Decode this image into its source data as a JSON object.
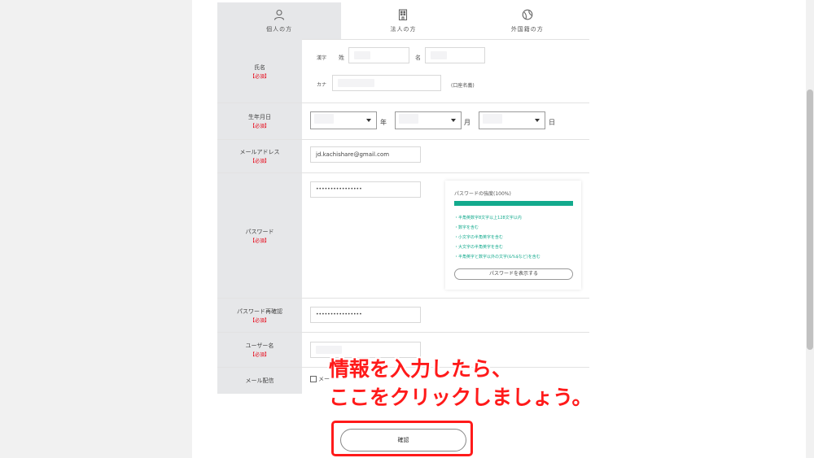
{
  "tabs": [
    {
      "label": "個人の方",
      "icon": "person-icon",
      "active": true
    },
    {
      "label": "法人の方",
      "icon": "building-icon",
      "active": false
    },
    {
      "label": "外国籍の方",
      "icon": "globe-icon",
      "active": false
    }
  ],
  "required_label": "【必須】",
  "name": {
    "label": "氏名",
    "kanji_label": "漢字",
    "last_label": "姓",
    "first_label": "名",
    "kana_label": "カナ",
    "kana_note": "(口座名義)"
  },
  "birthdate": {
    "label": "生年月日",
    "year_unit": "年",
    "month_unit": "月",
    "day_unit": "日"
  },
  "email": {
    "label": "メールアドレス",
    "value": "jd.kachishare@gmail.com"
  },
  "password": {
    "label": "パスワード",
    "value": "••••••••••••••••",
    "strength_title": "パスワードの強度(100%)",
    "strength_percent": 100,
    "rules": [
      "・半角英数字8文字以上128文字以内",
      "・数字を含む",
      "・小文字の半角英字を含む",
      "・大文字の半角英字を含む",
      "・半角英字と数字以外の文字(&%$など)を含む"
    ],
    "show_button": "パスワードを表示する"
  },
  "password_confirm": {
    "label": "パスワード再確認",
    "value": "••••••••••••••••"
  },
  "username": {
    "label": "ユーザー名"
  },
  "newsletter": {
    "label": "メール配信",
    "checkbox_text": "メー"
  },
  "annotation": {
    "line1": "情報を入力したら、",
    "line2": "ここをクリックしましょう。",
    "color": "#ff1a1a"
  },
  "confirm_button": "確認",
  "colors": {
    "accent": "#13aa8d",
    "required": "#e60012",
    "label_bg": "#e6e7e9"
  }
}
